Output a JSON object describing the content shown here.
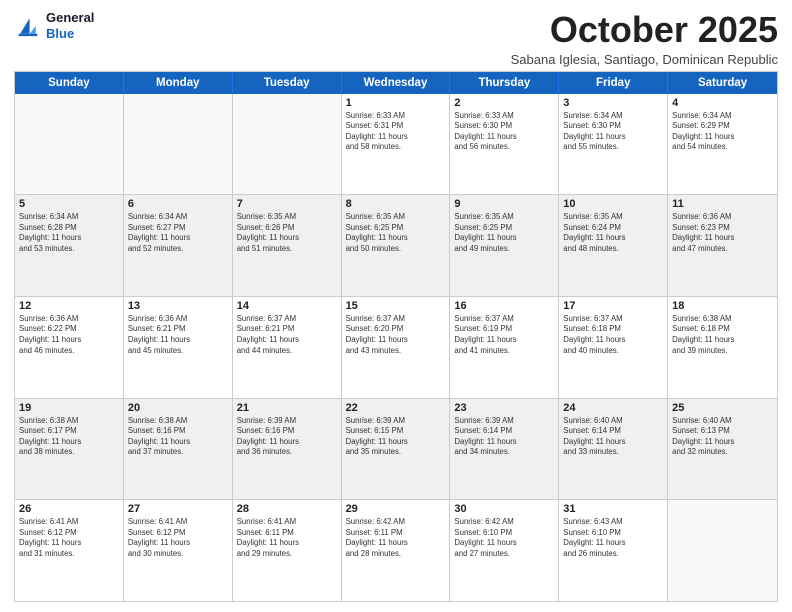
{
  "header": {
    "logo_line1": "General",
    "logo_line2": "Blue",
    "month_title": "October 2025",
    "subtitle": "Sabana Iglesia, Santiago, Dominican Republic"
  },
  "weekdays": [
    "Sunday",
    "Monday",
    "Tuesday",
    "Wednesday",
    "Thursday",
    "Friday",
    "Saturday"
  ],
  "rows": [
    [
      {
        "day": "",
        "info": ""
      },
      {
        "day": "",
        "info": ""
      },
      {
        "day": "",
        "info": ""
      },
      {
        "day": "1",
        "info": "Sunrise: 6:33 AM\nSunset: 6:31 PM\nDaylight: 11 hours\nand 58 minutes."
      },
      {
        "day": "2",
        "info": "Sunrise: 6:33 AM\nSunset: 6:30 PM\nDaylight: 11 hours\nand 56 minutes."
      },
      {
        "day": "3",
        "info": "Sunrise: 6:34 AM\nSunset: 6:30 PM\nDaylight: 11 hours\nand 55 minutes."
      },
      {
        "day": "4",
        "info": "Sunrise: 6:34 AM\nSunset: 6:29 PM\nDaylight: 11 hours\nand 54 minutes."
      }
    ],
    [
      {
        "day": "5",
        "info": "Sunrise: 6:34 AM\nSunset: 6:28 PM\nDaylight: 11 hours\nand 53 minutes."
      },
      {
        "day": "6",
        "info": "Sunrise: 6:34 AM\nSunset: 6:27 PM\nDaylight: 11 hours\nand 52 minutes."
      },
      {
        "day": "7",
        "info": "Sunrise: 6:35 AM\nSunset: 6:26 PM\nDaylight: 11 hours\nand 51 minutes."
      },
      {
        "day": "8",
        "info": "Sunrise: 6:35 AM\nSunset: 6:25 PM\nDaylight: 11 hours\nand 50 minutes."
      },
      {
        "day": "9",
        "info": "Sunrise: 6:35 AM\nSunset: 6:25 PM\nDaylight: 11 hours\nand 49 minutes."
      },
      {
        "day": "10",
        "info": "Sunrise: 6:35 AM\nSunset: 6:24 PM\nDaylight: 11 hours\nand 48 minutes."
      },
      {
        "day": "11",
        "info": "Sunrise: 6:36 AM\nSunset: 6:23 PM\nDaylight: 11 hours\nand 47 minutes."
      }
    ],
    [
      {
        "day": "12",
        "info": "Sunrise: 6:36 AM\nSunset: 6:22 PM\nDaylight: 11 hours\nand 46 minutes."
      },
      {
        "day": "13",
        "info": "Sunrise: 6:36 AM\nSunset: 6:21 PM\nDaylight: 11 hours\nand 45 minutes."
      },
      {
        "day": "14",
        "info": "Sunrise: 6:37 AM\nSunset: 6:21 PM\nDaylight: 11 hours\nand 44 minutes."
      },
      {
        "day": "15",
        "info": "Sunrise: 6:37 AM\nSunset: 6:20 PM\nDaylight: 11 hours\nand 43 minutes."
      },
      {
        "day": "16",
        "info": "Sunrise: 6:37 AM\nSunset: 6:19 PM\nDaylight: 11 hours\nand 41 minutes."
      },
      {
        "day": "17",
        "info": "Sunrise: 6:37 AM\nSunset: 6:18 PM\nDaylight: 11 hours\nand 40 minutes."
      },
      {
        "day": "18",
        "info": "Sunrise: 6:38 AM\nSunset: 6:18 PM\nDaylight: 11 hours\nand 39 minutes."
      }
    ],
    [
      {
        "day": "19",
        "info": "Sunrise: 6:38 AM\nSunset: 6:17 PM\nDaylight: 11 hours\nand 38 minutes."
      },
      {
        "day": "20",
        "info": "Sunrise: 6:38 AM\nSunset: 6:16 PM\nDaylight: 11 hours\nand 37 minutes."
      },
      {
        "day": "21",
        "info": "Sunrise: 6:39 AM\nSunset: 6:16 PM\nDaylight: 11 hours\nand 36 minutes."
      },
      {
        "day": "22",
        "info": "Sunrise: 6:39 AM\nSunset: 6:15 PM\nDaylight: 11 hours\nand 35 minutes."
      },
      {
        "day": "23",
        "info": "Sunrise: 6:39 AM\nSunset: 6:14 PM\nDaylight: 11 hours\nand 34 minutes."
      },
      {
        "day": "24",
        "info": "Sunrise: 6:40 AM\nSunset: 6:14 PM\nDaylight: 11 hours\nand 33 minutes."
      },
      {
        "day": "25",
        "info": "Sunrise: 6:40 AM\nSunset: 6:13 PM\nDaylight: 11 hours\nand 32 minutes."
      }
    ],
    [
      {
        "day": "26",
        "info": "Sunrise: 6:41 AM\nSunset: 6:12 PM\nDaylight: 11 hours\nand 31 minutes."
      },
      {
        "day": "27",
        "info": "Sunrise: 6:41 AM\nSunset: 6:12 PM\nDaylight: 11 hours\nand 30 minutes."
      },
      {
        "day": "28",
        "info": "Sunrise: 6:41 AM\nSunset: 6:11 PM\nDaylight: 11 hours\nand 29 minutes."
      },
      {
        "day": "29",
        "info": "Sunrise: 6:42 AM\nSunset: 6:11 PM\nDaylight: 11 hours\nand 28 minutes."
      },
      {
        "day": "30",
        "info": "Sunrise: 6:42 AM\nSunset: 6:10 PM\nDaylight: 11 hours\nand 27 minutes."
      },
      {
        "day": "31",
        "info": "Sunrise: 6:43 AM\nSunset: 6:10 PM\nDaylight: 11 hours\nand 26 minutes."
      },
      {
        "day": "",
        "info": ""
      }
    ]
  ]
}
